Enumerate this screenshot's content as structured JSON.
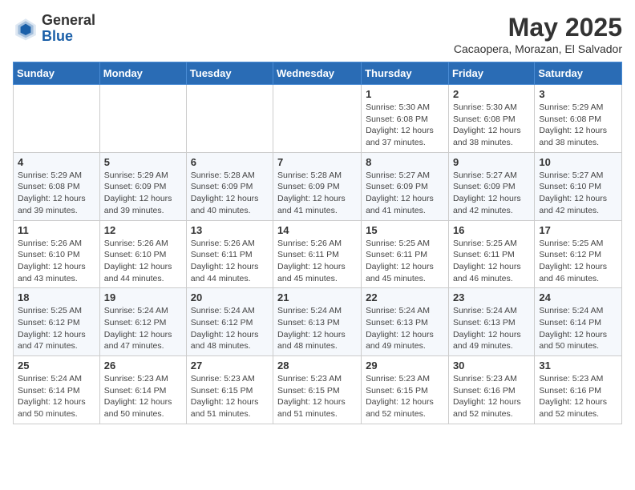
{
  "logo": {
    "general": "General",
    "blue": "Blue"
  },
  "title": "May 2025",
  "subtitle": "Cacaopera, Morazan, El Salvador",
  "days_of_week": [
    "Sunday",
    "Monday",
    "Tuesday",
    "Wednesday",
    "Thursday",
    "Friday",
    "Saturday"
  ],
  "weeks": [
    [
      {
        "day": "",
        "info": ""
      },
      {
        "day": "",
        "info": ""
      },
      {
        "day": "",
        "info": ""
      },
      {
        "day": "",
        "info": ""
      },
      {
        "day": "1",
        "info": "Sunrise: 5:30 AM\nSunset: 6:08 PM\nDaylight: 12 hours\nand 37 minutes."
      },
      {
        "day": "2",
        "info": "Sunrise: 5:30 AM\nSunset: 6:08 PM\nDaylight: 12 hours\nand 38 minutes."
      },
      {
        "day": "3",
        "info": "Sunrise: 5:29 AM\nSunset: 6:08 PM\nDaylight: 12 hours\nand 38 minutes."
      }
    ],
    [
      {
        "day": "4",
        "info": "Sunrise: 5:29 AM\nSunset: 6:08 PM\nDaylight: 12 hours\nand 39 minutes."
      },
      {
        "day": "5",
        "info": "Sunrise: 5:29 AM\nSunset: 6:09 PM\nDaylight: 12 hours\nand 39 minutes."
      },
      {
        "day": "6",
        "info": "Sunrise: 5:28 AM\nSunset: 6:09 PM\nDaylight: 12 hours\nand 40 minutes."
      },
      {
        "day": "7",
        "info": "Sunrise: 5:28 AM\nSunset: 6:09 PM\nDaylight: 12 hours\nand 41 minutes."
      },
      {
        "day": "8",
        "info": "Sunrise: 5:27 AM\nSunset: 6:09 PM\nDaylight: 12 hours\nand 41 minutes."
      },
      {
        "day": "9",
        "info": "Sunrise: 5:27 AM\nSunset: 6:09 PM\nDaylight: 12 hours\nand 42 minutes."
      },
      {
        "day": "10",
        "info": "Sunrise: 5:27 AM\nSunset: 6:10 PM\nDaylight: 12 hours\nand 42 minutes."
      }
    ],
    [
      {
        "day": "11",
        "info": "Sunrise: 5:26 AM\nSunset: 6:10 PM\nDaylight: 12 hours\nand 43 minutes."
      },
      {
        "day": "12",
        "info": "Sunrise: 5:26 AM\nSunset: 6:10 PM\nDaylight: 12 hours\nand 44 minutes."
      },
      {
        "day": "13",
        "info": "Sunrise: 5:26 AM\nSunset: 6:11 PM\nDaylight: 12 hours\nand 44 minutes."
      },
      {
        "day": "14",
        "info": "Sunrise: 5:26 AM\nSunset: 6:11 PM\nDaylight: 12 hours\nand 45 minutes."
      },
      {
        "day": "15",
        "info": "Sunrise: 5:25 AM\nSunset: 6:11 PM\nDaylight: 12 hours\nand 45 minutes."
      },
      {
        "day": "16",
        "info": "Sunrise: 5:25 AM\nSunset: 6:11 PM\nDaylight: 12 hours\nand 46 minutes."
      },
      {
        "day": "17",
        "info": "Sunrise: 5:25 AM\nSunset: 6:12 PM\nDaylight: 12 hours\nand 46 minutes."
      }
    ],
    [
      {
        "day": "18",
        "info": "Sunrise: 5:25 AM\nSunset: 6:12 PM\nDaylight: 12 hours\nand 47 minutes."
      },
      {
        "day": "19",
        "info": "Sunrise: 5:24 AM\nSunset: 6:12 PM\nDaylight: 12 hours\nand 47 minutes."
      },
      {
        "day": "20",
        "info": "Sunrise: 5:24 AM\nSunset: 6:12 PM\nDaylight: 12 hours\nand 48 minutes."
      },
      {
        "day": "21",
        "info": "Sunrise: 5:24 AM\nSunset: 6:13 PM\nDaylight: 12 hours\nand 48 minutes."
      },
      {
        "day": "22",
        "info": "Sunrise: 5:24 AM\nSunset: 6:13 PM\nDaylight: 12 hours\nand 49 minutes."
      },
      {
        "day": "23",
        "info": "Sunrise: 5:24 AM\nSunset: 6:13 PM\nDaylight: 12 hours\nand 49 minutes."
      },
      {
        "day": "24",
        "info": "Sunrise: 5:24 AM\nSunset: 6:14 PM\nDaylight: 12 hours\nand 50 minutes."
      }
    ],
    [
      {
        "day": "25",
        "info": "Sunrise: 5:24 AM\nSunset: 6:14 PM\nDaylight: 12 hours\nand 50 minutes."
      },
      {
        "day": "26",
        "info": "Sunrise: 5:23 AM\nSunset: 6:14 PM\nDaylight: 12 hours\nand 50 minutes."
      },
      {
        "day": "27",
        "info": "Sunrise: 5:23 AM\nSunset: 6:15 PM\nDaylight: 12 hours\nand 51 minutes."
      },
      {
        "day": "28",
        "info": "Sunrise: 5:23 AM\nSunset: 6:15 PM\nDaylight: 12 hours\nand 51 minutes."
      },
      {
        "day": "29",
        "info": "Sunrise: 5:23 AM\nSunset: 6:15 PM\nDaylight: 12 hours\nand 52 minutes."
      },
      {
        "day": "30",
        "info": "Sunrise: 5:23 AM\nSunset: 6:16 PM\nDaylight: 12 hours\nand 52 minutes."
      },
      {
        "day": "31",
        "info": "Sunrise: 5:23 AM\nSunset: 6:16 PM\nDaylight: 12 hours\nand 52 minutes."
      }
    ]
  ]
}
